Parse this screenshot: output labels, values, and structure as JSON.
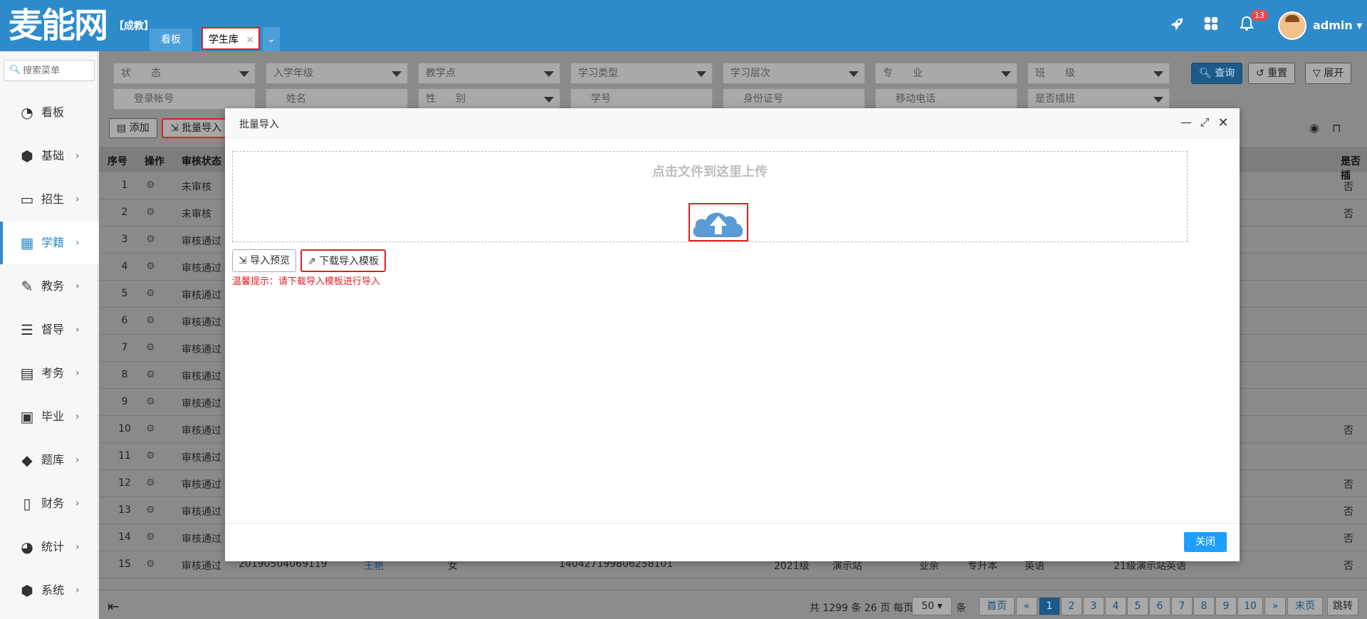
{
  "header": {
    "logo": "麦能网",
    "logo_sub": "【成教】",
    "tabs": [
      {
        "label": "看板"
      },
      {
        "label": "学生库",
        "close": "×"
      }
    ],
    "more_icon": "chevron-down-icon",
    "notification_count": "13",
    "user": "admin"
  },
  "sidebar": {
    "search_placeholder": "搜索菜单",
    "items": [
      {
        "label": "看板",
        "icon": "dashboard-icon"
      },
      {
        "label": "基础",
        "icon": "cube-icon"
      },
      {
        "label": "招生",
        "icon": "monitor-icon"
      },
      {
        "label": "学籍",
        "icon": "table-icon"
      },
      {
        "label": "教务",
        "icon": "edit-icon"
      },
      {
        "label": "督导",
        "icon": "list-icon"
      },
      {
        "label": "考务",
        "icon": "calendar-icon"
      },
      {
        "label": "毕业",
        "icon": "image-icon"
      },
      {
        "label": "题库",
        "icon": "tag-icon"
      },
      {
        "label": "财务",
        "icon": "document-icon"
      },
      {
        "label": "统计",
        "icon": "gauge-icon"
      },
      {
        "label": "系统",
        "icon": "cube-icon"
      }
    ]
  },
  "filters": {
    "row1": [
      "状　　态",
      "入学年级",
      "教学点",
      "学习类型",
      "学习层次",
      "专　　业",
      "班　　级"
    ],
    "row2": [
      "登录帐号",
      "姓名",
      "性　　别",
      "学号",
      "身份证号",
      "移动电话",
      "是否插班"
    ],
    "query": "查询",
    "reset": "重置",
    "expand": "展开"
  },
  "toolbar": {
    "add": "添加",
    "import": "批量导入"
  },
  "table": {
    "headers": [
      "序号",
      "操作",
      "审核状态",
      "是否插"
    ],
    "rows": [
      {
        "idx": "1",
        "status": "未审核",
        "flag": "否"
      },
      {
        "idx": "2",
        "status": "未审核",
        "flag": "否"
      },
      {
        "idx": "3",
        "status": "审核通过",
        "flag": ""
      },
      {
        "idx": "4",
        "status": "审核通过",
        "flag": ""
      },
      {
        "idx": "5",
        "status": "审核通过",
        "flag": ""
      },
      {
        "idx": "6",
        "status": "审核通过",
        "flag": ""
      },
      {
        "idx": "7",
        "status": "审核通过",
        "flag": ""
      },
      {
        "idx": "8",
        "status": "审核通过",
        "flag": ""
      },
      {
        "idx": "9",
        "status": "审核通过",
        "flag": ""
      },
      {
        "idx": "10",
        "status": "审核通过",
        "flag": "否"
      },
      {
        "idx": "11",
        "status": "审核通过",
        "flag": ""
      },
      {
        "idx": "12",
        "status": "审核通过",
        "flag": "否"
      },
      {
        "idx": "13",
        "status": "审核通过",
        "flag": "否"
      },
      {
        "idx": "14",
        "status": "审核通过",
        "flag": "否"
      },
      {
        "idx": "15",
        "status": "审核通过",
        "flag": "否",
        "login": "20190504069119",
        "name": "王艳",
        "gender": "女",
        "id_card": "140427199806258101",
        "grade": "2021级",
        "site": "演示站",
        "type": "业余",
        "level": "专升本",
        "major": "英语",
        "class": "21级演示站英语"
      }
    ]
  },
  "pagination": {
    "summary_prefix": "共 1299 条 26 页 每页",
    "per_page": "50",
    "summary_suffix": "条",
    "first": "首页",
    "prev": "«",
    "pages": [
      "1",
      "2",
      "3",
      "4",
      "5",
      "6",
      "7",
      "8",
      "9",
      "10"
    ],
    "next": "»",
    "last": "末页",
    "jump": "跳转"
  },
  "modal": {
    "title": "批量导入",
    "dropzone_text": "点击文件到这里上传",
    "preview_btn": "导入预览",
    "download_btn": "下载导入模板",
    "tip": "温馨提示：请下载导入模板进行导入",
    "close_btn": "关闭"
  },
  "colors": {
    "header_bg": "#2e8bcb",
    "accent": "#1e9fff",
    "highlight": "#e02020"
  }
}
